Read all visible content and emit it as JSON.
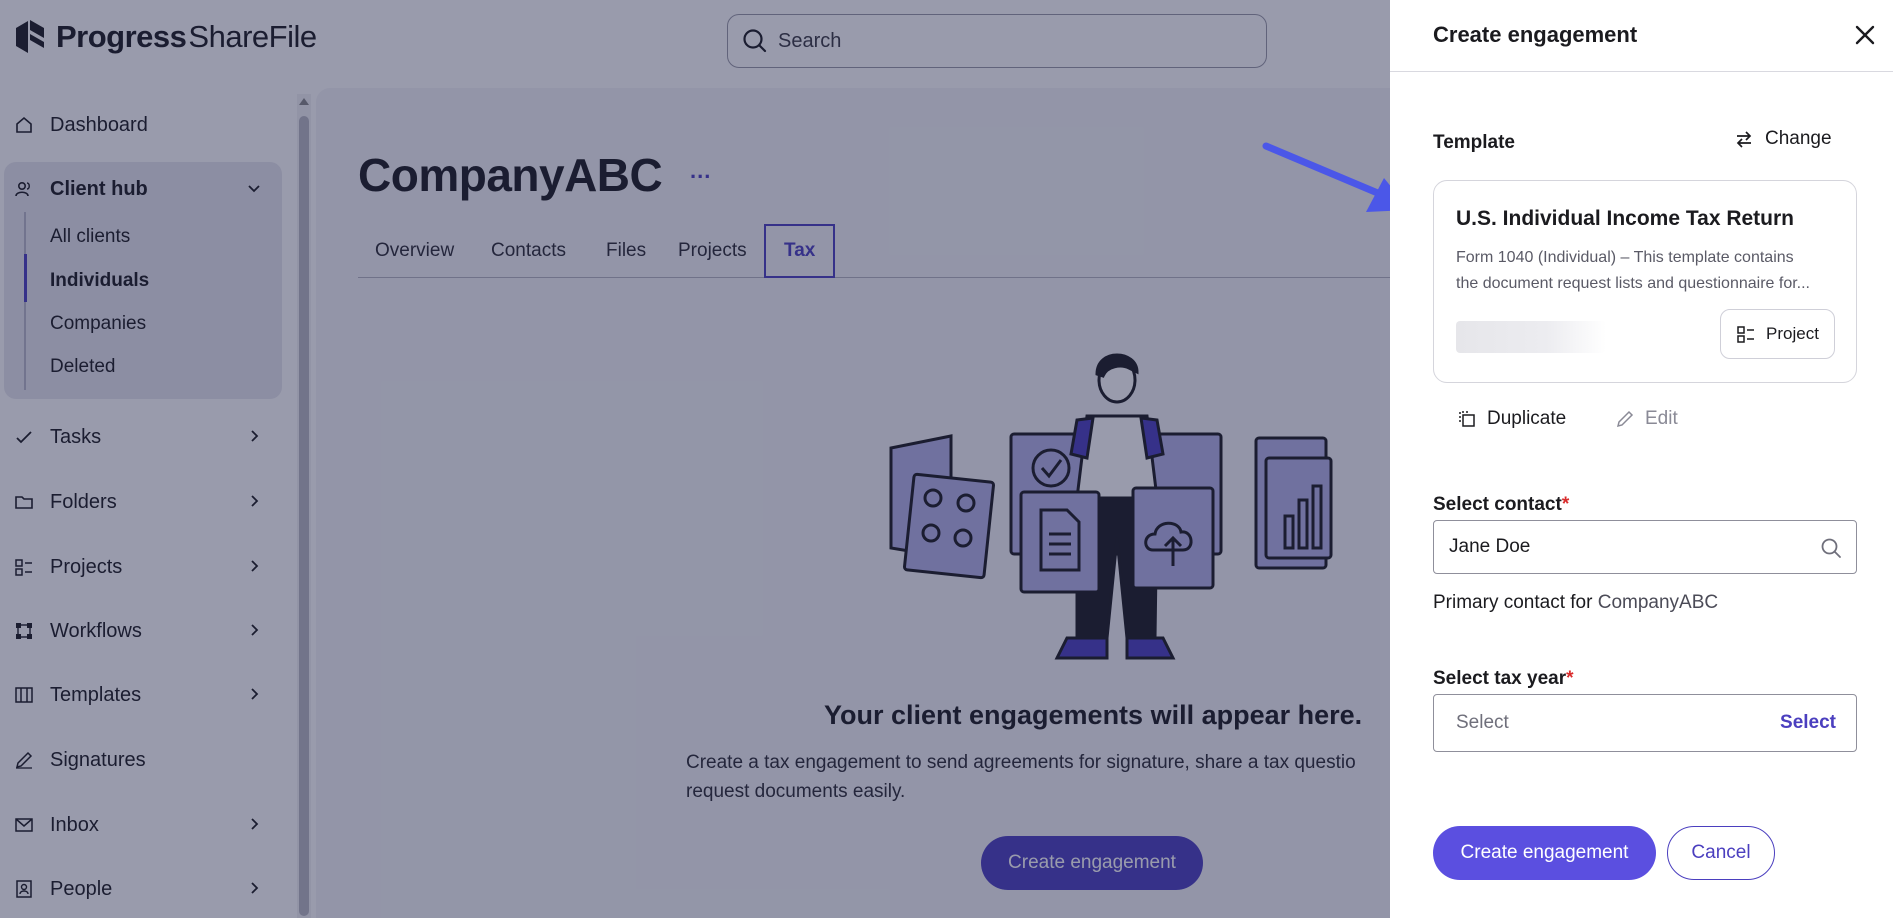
{
  "brand": {
    "name_main": "Progress",
    "name_sub": "ShareFile"
  },
  "search": {
    "placeholder": "Search"
  },
  "sidebar": {
    "items": [
      {
        "label": "Dashboard",
        "icon": "home-icon"
      },
      {
        "label": "Client hub",
        "icon": "users-icon",
        "expanded": true
      },
      {
        "label": "Tasks",
        "icon": "check-icon"
      },
      {
        "label": "Folders",
        "icon": "folder-icon"
      },
      {
        "label": "Projects",
        "icon": "projects-icon"
      },
      {
        "label": "Workflows",
        "icon": "workflow-icon"
      },
      {
        "label": "Templates",
        "icon": "template-icon"
      },
      {
        "label": "Signatures",
        "icon": "pen-icon"
      },
      {
        "label": "Inbox",
        "icon": "mail-icon"
      },
      {
        "label": "People",
        "icon": "person-icon"
      }
    ],
    "client_hub_sub": [
      "All clients",
      "Individuals",
      "Companies",
      "Deleted"
    ],
    "active_sub": "Individuals"
  },
  "main": {
    "title": "CompanyABC",
    "more": "...",
    "tabs": [
      "Overview",
      "Contacts",
      "Files",
      "Projects",
      "Tax"
    ],
    "active_tab": "Tax",
    "empty_title": "Your client engagements will appear here.",
    "empty_desc_line1": "Create a tax engagement to send agreements for signature, share a tax questio",
    "empty_desc_line2": "request documents easily.",
    "create_button": "Create engagement"
  },
  "drawer": {
    "title": "Create engagement",
    "template_label": "Template",
    "change_label": "Change",
    "template_card": {
      "title": "U.S. Individual Income Tax Return",
      "desc_line1": "Form 1040 (Individual) – This template contains",
      "desc_line2": "the document request lists and questionnaire for...",
      "chip": "Project"
    },
    "duplicate_label": "Duplicate",
    "edit_label": "Edit",
    "contact_label": "Select contact",
    "contact_value": "Jane Doe",
    "primary_prefix": "Primary contact for ",
    "primary_company": "CompanyABC",
    "taxyear_label": "Select tax year",
    "taxyear_placeholder": "Select",
    "taxyear_link": "Select",
    "create_button": "Create engagement",
    "cancel_button": "Cancel",
    "required_mark": "*"
  },
  "colors": {
    "accent": "#4b3fbf",
    "button": "#5b4fe0",
    "overlay": "#1c2246",
    "arrow": "#4b57e8",
    "required": "#d92b2b"
  }
}
